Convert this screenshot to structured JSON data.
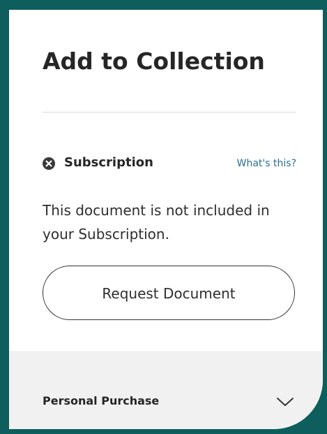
{
  "panel": {
    "title": "Add to Collection"
  },
  "subscription": {
    "icon": "x-circle-icon",
    "label": "Subscription",
    "help_link": "What's this?",
    "message": "This document is not included in your Subscription."
  },
  "actions": {
    "request_label": "Request Document"
  },
  "personal_purchase": {
    "label": "Personal Purchase",
    "icon": "chevron-down-icon"
  },
  "colors": {
    "frame": "#0d5e5c",
    "link": "#2d6d8f",
    "section_bg": "#f1f1f1"
  }
}
